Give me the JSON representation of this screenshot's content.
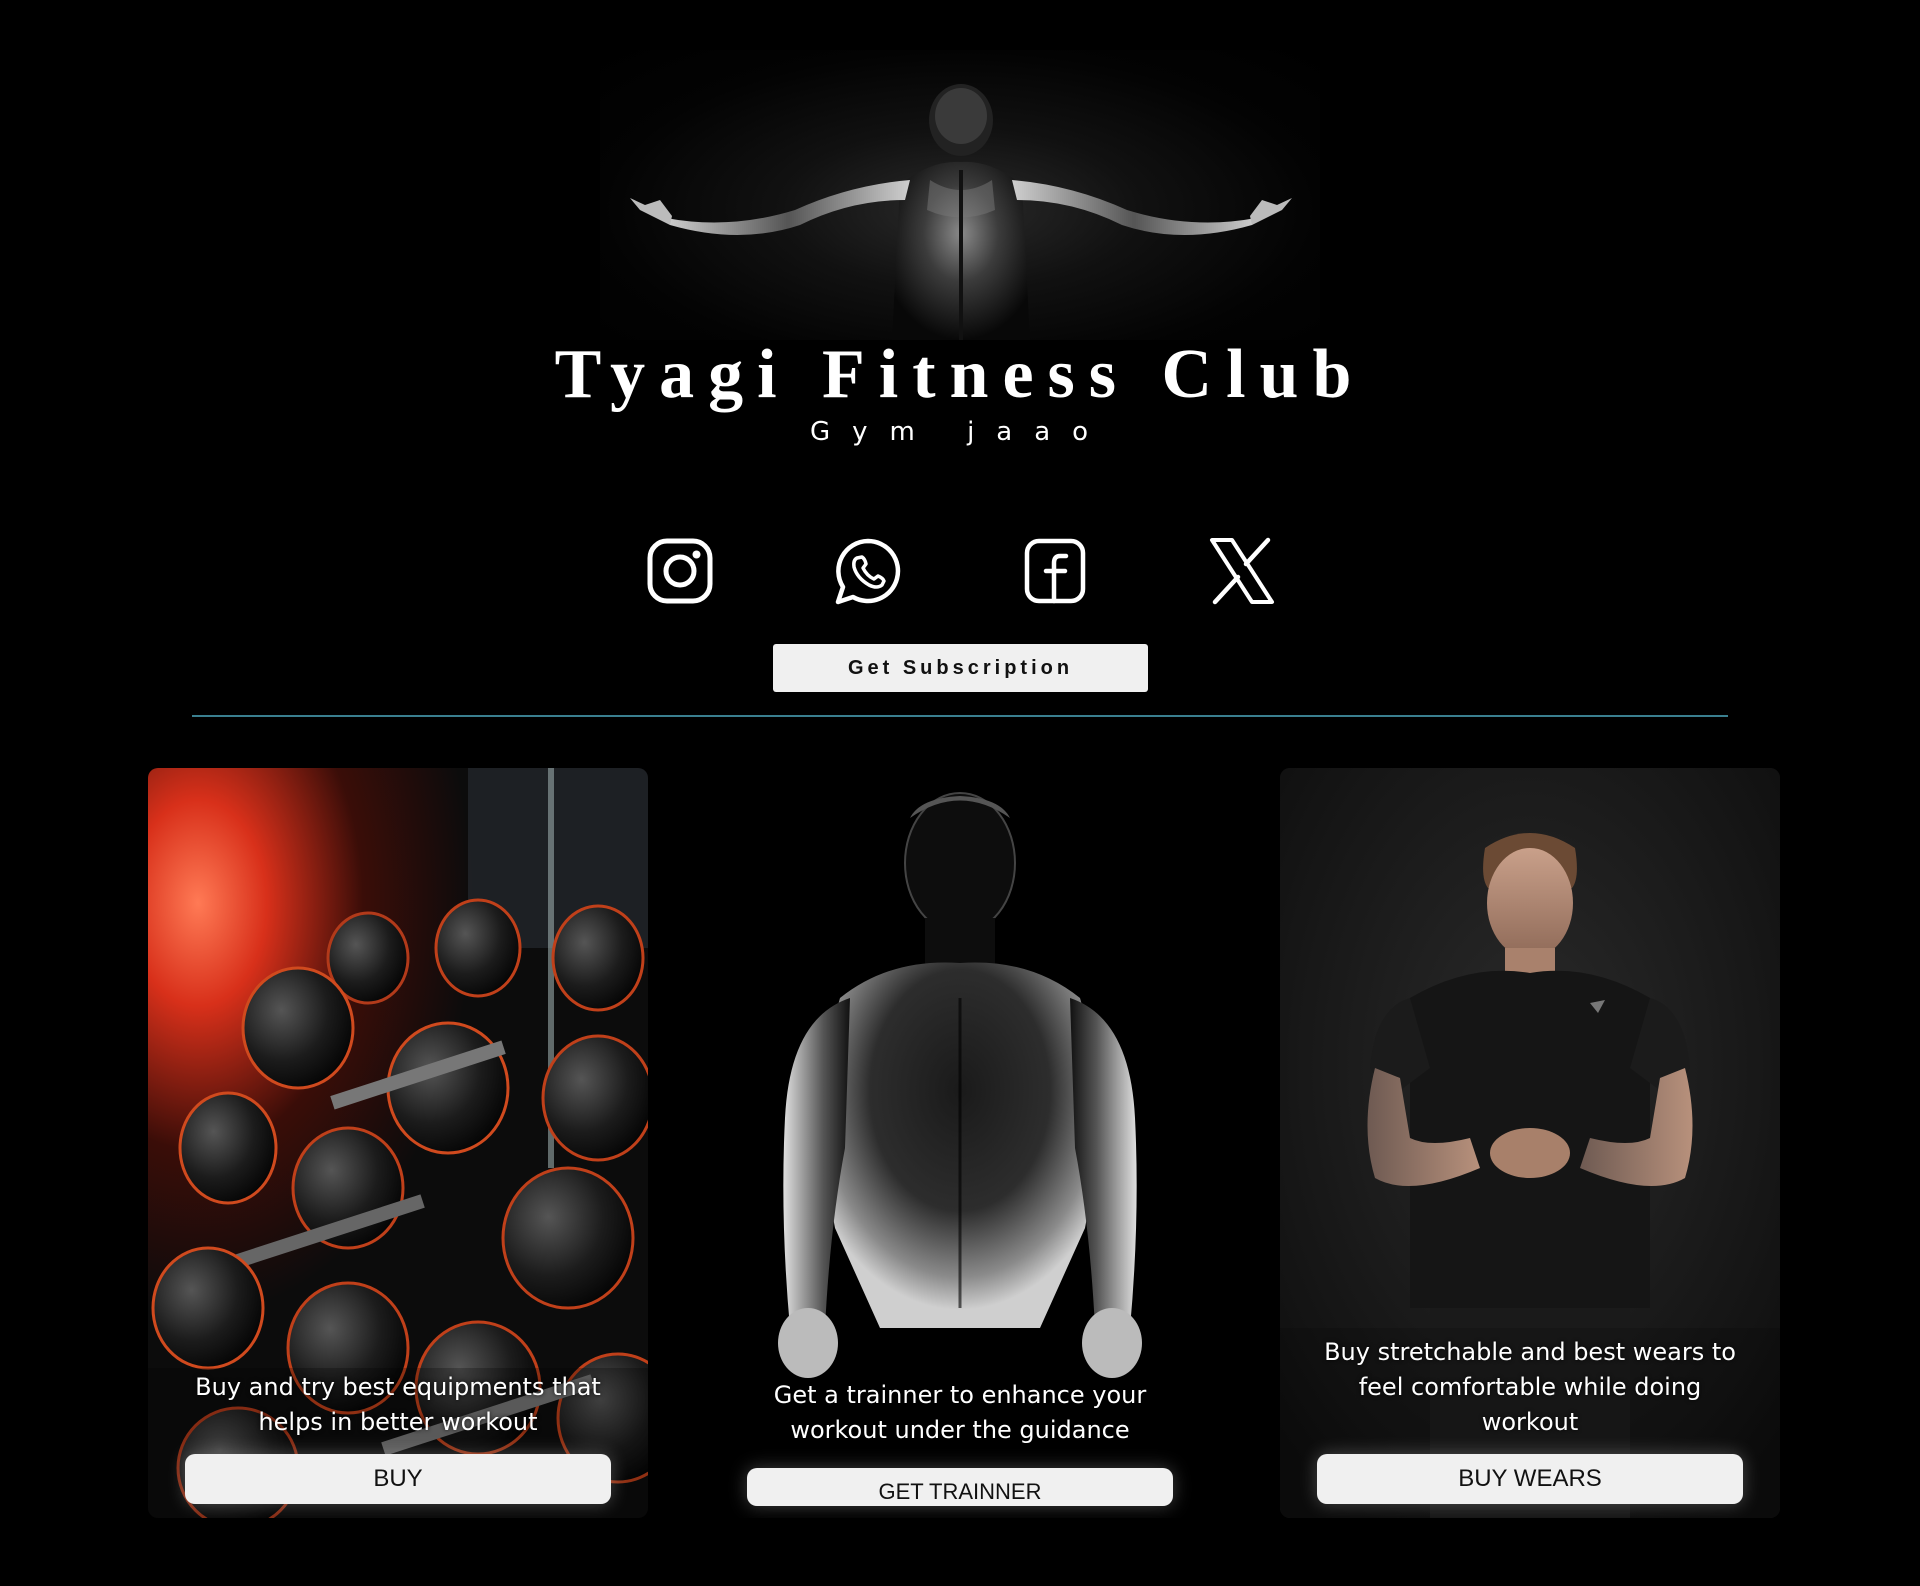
{
  "header": {
    "title": "Tyagi Fitness Club",
    "tagline": "Gym jaao"
  },
  "social": [
    {
      "icon": "instagram-icon",
      "label": "Instagram"
    },
    {
      "icon": "whatsapp-icon",
      "label": "WhatsApp"
    },
    {
      "icon": "facebook-icon",
      "label": "Facebook"
    },
    {
      "icon": "x-icon",
      "label": "X"
    }
  ],
  "subscription_button": "Get  Subscription",
  "cards": [
    {
      "text": "Buy and try best equipments that helps in better workout",
      "button": "BUY"
    },
    {
      "text": "Get a trainner to enhance your workout under the guidance",
      "button": "GET TRAINNER"
    },
    {
      "text": "Buy stretchable and best wears to feel comfortable while doing workout",
      "button": "BUY WEARS"
    }
  ],
  "colors": {
    "background": "#000000",
    "divider": "#3a7f8f",
    "button_bg": "#f0f0f0"
  }
}
